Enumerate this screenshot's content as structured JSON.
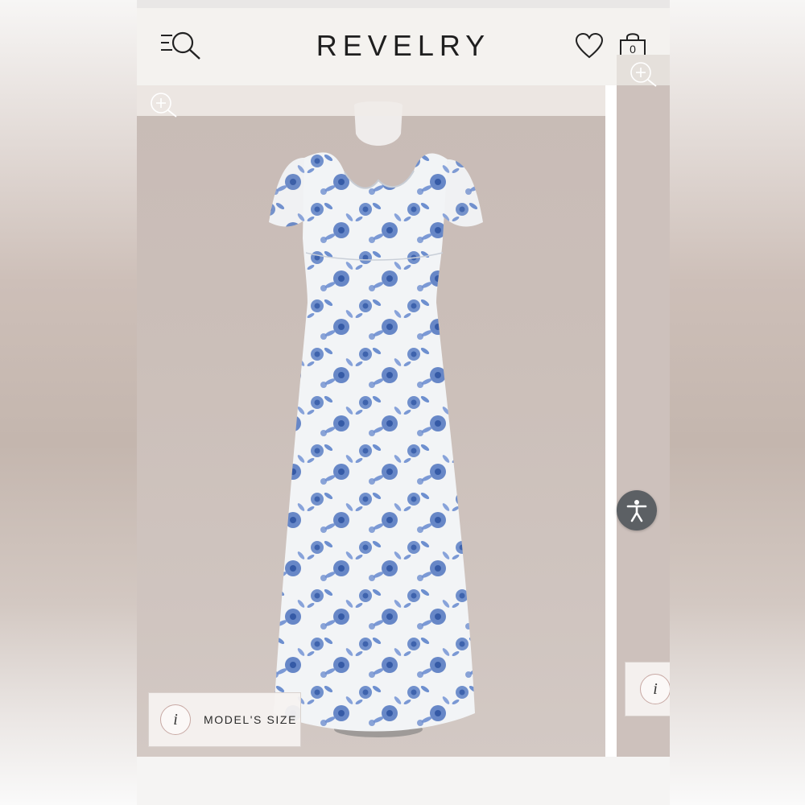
{
  "brand": {
    "name": "REVELRY"
  },
  "header": {
    "menu_icon": "menu-search-icon",
    "wishlist_icon": "heart-icon",
    "cart_icon": "shopping-bag-icon",
    "cart_count": "0"
  },
  "gallery": {
    "zoom_icon": "zoom-in-icon",
    "current_image": "floral-maxi-dress-on-mannequin",
    "model_size_label": "MODEL'S SIZE",
    "info_glyph": "i"
  },
  "accessibility": {
    "icon": "accessibility-icon"
  },
  "colors": {
    "background": "#c9bcb6",
    "header": "#f4f2ef",
    "text": "#1f1f1f",
    "floral_blue": "#5b7fc4",
    "a11y_button": "#5c6064"
  }
}
